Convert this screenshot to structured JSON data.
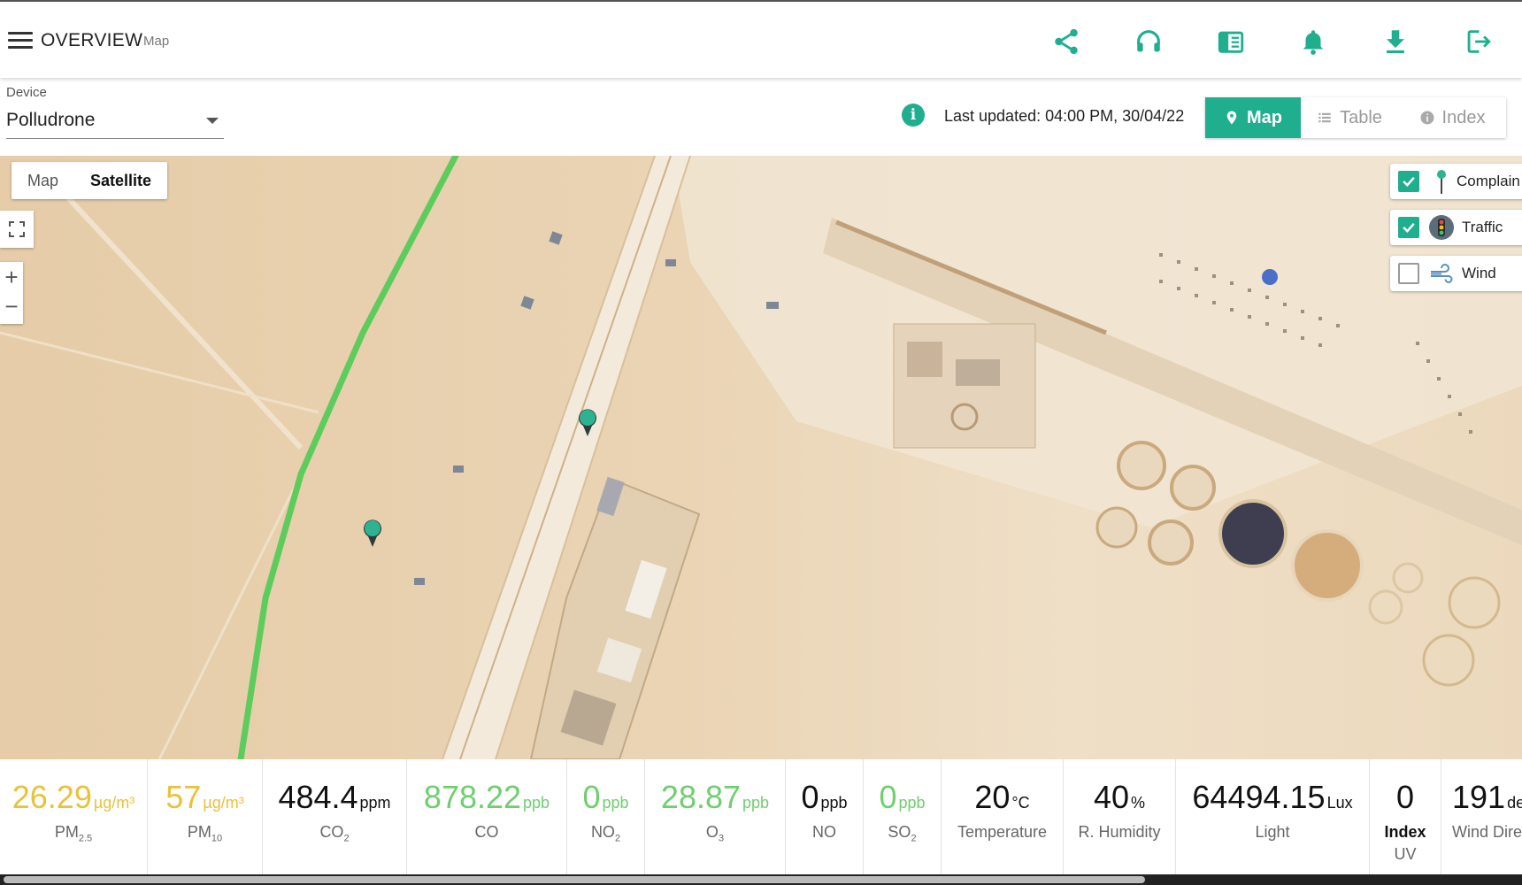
{
  "header": {
    "title": "OVERVIEW",
    "subtitle": "Map",
    "icons": [
      "share-icon",
      "headset-icon",
      "reader-icon",
      "bell-icon",
      "download-icon",
      "logout-icon"
    ]
  },
  "device": {
    "label": "Device",
    "value": "Polludrone"
  },
  "status": {
    "last_updated": "Last updated: 04:00 PM, 30/04/22"
  },
  "view_tabs": [
    {
      "label": "Map",
      "active": true
    },
    {
      "label": "Table",
      "active": false
    },
    {
      "label": "Index",
      "active": false
    }
  ],
  "map": {
    "type_buttons": [
      {
        "label": "Map",
        "active": false
      },
      {
        "label": "Satellite",
        "active": true
      }
    ],
    "layers": [
      {
        "label": "Complain",
        "checked": true
      },
      {
        "label": "Traffic",
        "checked": true
      },
      {
        "label": "Wind",
        "checked": false
      }
    ]
  },
  "stats": [
    {
      "value": "26.29",
      "unit": "µg/m³",
      "name": "PM",
      "sub": "2.5",
      "color": "yellow"
    },
    {
      "value": "57",
      "unit": "µg/m³",
      "name": "PM",
      "sub": "10",
      "color": "yellow"
    },
    {
      "value": "484.4",
      "unit": "ppm",
      "name": "CO",
      "sub": "2",
      "color": "dark"
    },
    {
      "value": "878.22",
      "unit": "ppb",
      "name": "CO",
      "sub": "",
      "color": "green"
    },
    {
      "value": "0",
      "unit": "ppb",
      "name": "NO",
      "sub": "2",
      "color": "green"
    },
    {
      "value": "28.87",
      "unit": "ppb",
      "name": "O",
      "sub": "3",
      "color": "green"
    },
    {
      "value": "0",
      "unit": "ppb",
      "name": "NO",
      "sub": "",
      "color": "dark"
    },
    {
      "value": "0",
      "unit": "ppb",
      "name": "SO",
      "sub": "2",
      "color": "green"
    },
    {
      "value": "20",
      "unit": "°C",
      "name": "Temperature",
      "sub": "",
      "color": "dark"
    },
    {
      "value": "40",
      "unit": "%",
      "name": "R. Humidity",
      "sub": "",
      "color": "dark"
    },
    {
      "value": "64494.15",
      "unit": "Lux",
      "name": "Light",
      "sub": "",
      "color": "dark"
    },
    {
      "value": "0",
      "unit": "",
      "name": "Index",
      "sub": "",
      "name2": "UV",
      "color": "dark"
    },
    {
      "value": "191",
      "unit": "de",
      "name": "Wind Direc",
      "sub": "",
      "color": "dark"
    }
  ],
  "colors": {
    "accent": "#1fae8e",
    "good": "#6fcf6f",
    "moderate": "#e8c23a"
  }
}
